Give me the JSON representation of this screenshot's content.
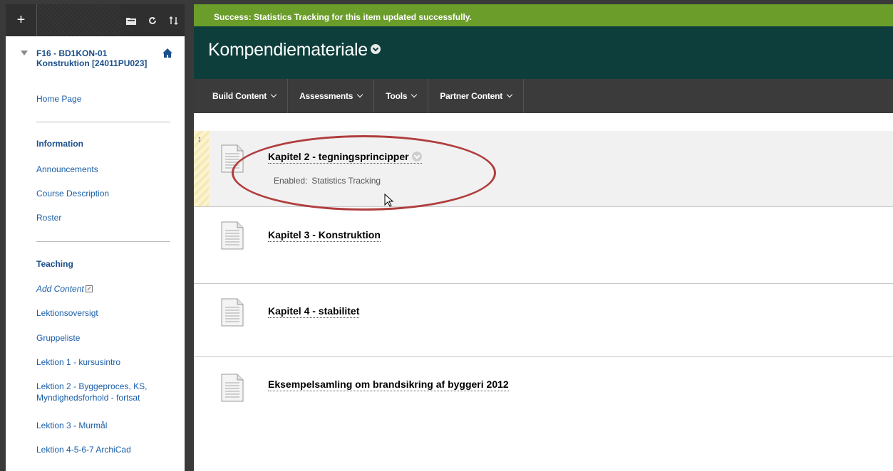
{
  "sidebar": {
    "toolbar": {
      "add_icon": "plus-icon",
      "icons": [
        "folder-icon",
        "refresh-icon",
        "sort-icon"
      ]
    },
    "course_title_line1": "F16 - BD1KON-01",
    "course_title_line2": "Konstruktion [24011PU023]",
    "home_link": "Home Page",
    "sections": [
      {
        "heading": "Information",
        "items": [
          "Announcements",
          "Course Description",
          "Roster"
        ]
      },
      {
        "heading": "Teaching",
        "add_content": "Add Content",
        "items": [
          "Lektionsoversigt",
          "Gruppeliste",
          "Lektion 1 - kursusintro",
          "Lektion 2 - Byggeproces, KS,",
          "Myndighedsforhold - fortsat",
          "Lektion 3 - Murmål",
          "Lektion 4-5-6-7 ArchiCad"
        ]
      }
    ]
  },
  "main": {
    "success_message": "Success: Statistics Tracking for this item updated successfully.",
    "page_title": "Kompendiemateriale",
    "action_bar": [
      "Build Content",
      "Assessments",
      "Tools",
      "Partner Content"
    ],
    "items": [
      {
        "title": "Kapitel 2 - tegningsprincipper",
        "detail_label": "Enabled:",
        "detail_value": "Statistics Tracking"
      },
      {
        "title": "Kapitel 3 - Konstruktion"
      },
      {
        "title": "Kapitel 4 - stabilitet"
      },
      {
        "title": "Eksempelsamling om brandsikring af byggeri 2012"
      }
    ]
  },
  "colors": {
    "success_bg": "#6a9d2a",
    "header_bg": "#0d3e3b",
    "action_bar_bg": "#3b3b3b",
    "link": "#1a5ea8",
    "annotation_ellipse": "#b13d3d"
  }
}
